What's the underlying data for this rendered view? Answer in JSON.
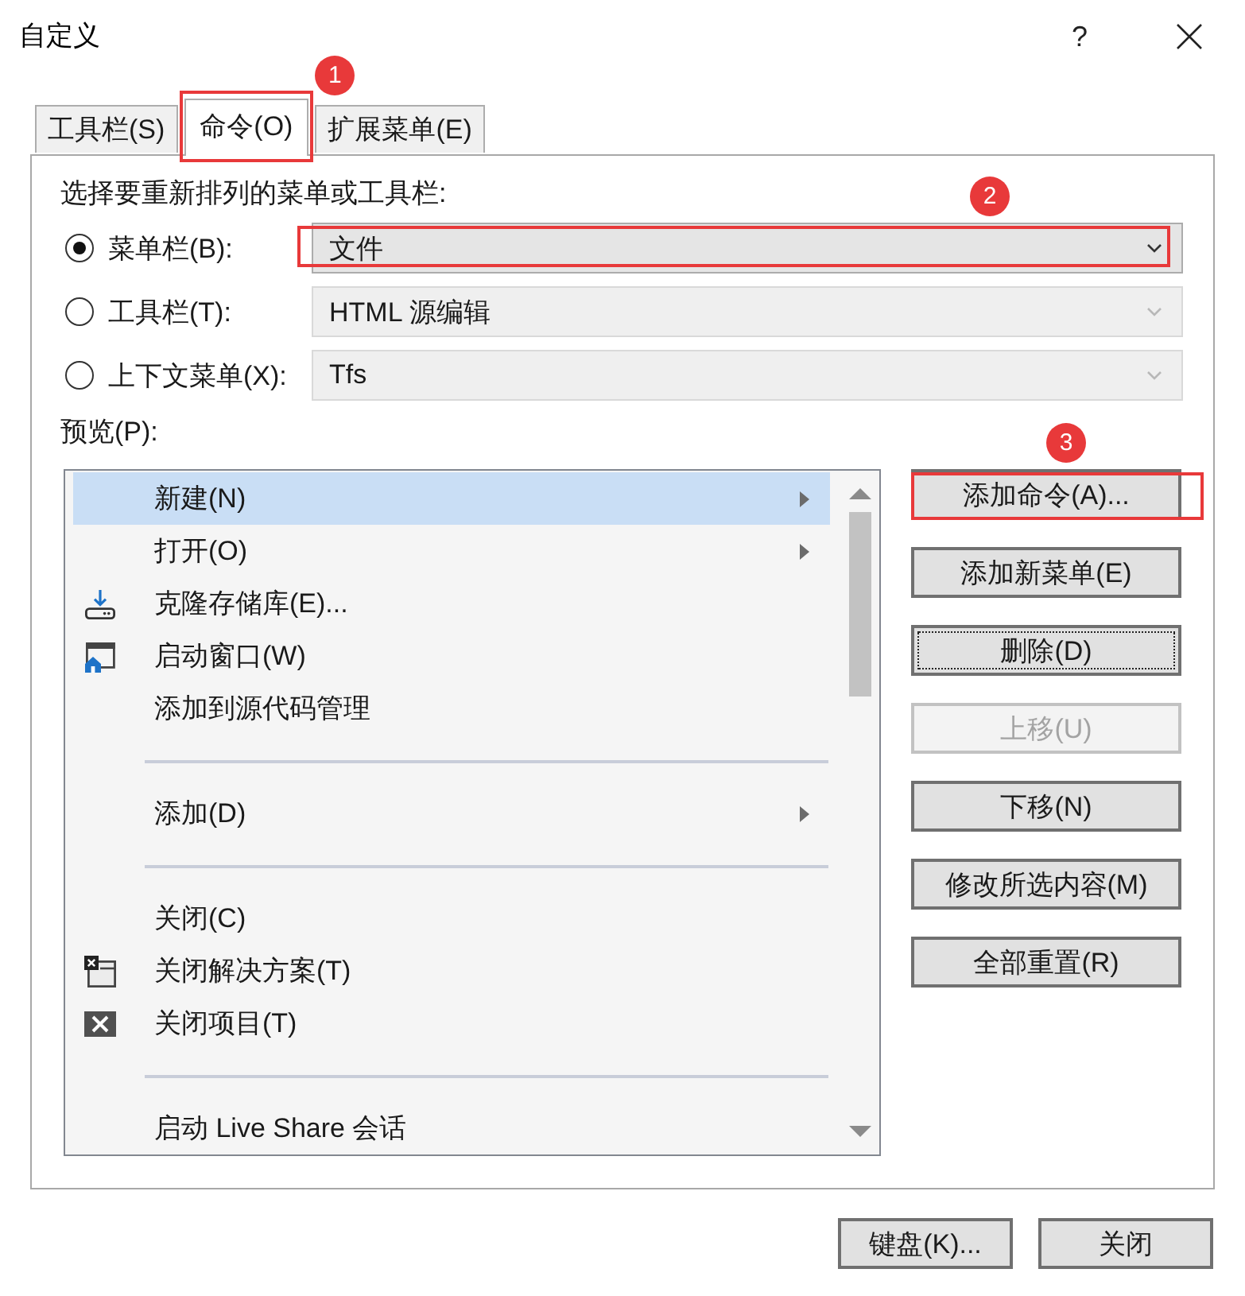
{
  "window": {
    "title": "自定义",
    "help_button": "?"
  },
  "tabs": [
    {
      "label": "工具栏(S)",
      "selected": false
    },
    {
      "label": "命令(O)",
      "selected": true,
      "callout": "1"
    },
    {
      "label": "扩展菜单(E)",
      "selected": false
    }
  ],
  "rearrange": {
    "prompt": "选择要重新排列的菜单或工具栏:",
    "options": [
      {
        "label": "菜单栏(B):",
        "selected": true,
        "value": "文件",
        "callout": "2"
      },
      {
        "label": "工具栏(T):",
        "selected": false,
        "value": "HTML 源编辑"
      },
      {
        "label": "上下文菜单(X):",
        "selected": false,
        "value": "Tfs"
      }
    ]
  },
  "preview": {
    "label": "预览(P):",
    "items": [
      {
        "kind": "command",
        "label": "新建(N)",
        "selected": true,
        "has_submenu": true
      },
      {
        "kind": "command",
        "label": "打开(O)",
        "selected": false,
        "has_submenu": true
      },
      {
        "kind": "clone",
        "label": "克隆存储库(E)...",
        "selected": false,
        "has_submenu": false
      },
      {
        "kind": "startwindow",
        "label": "启动窗口(W)",
        "selected": false,
        "has_submenu": false
      },
      {
        "kind": "command",
        "label": "添加到源代码管理",
        "selected": false,
        "has_submenu": false
      },
      {
        "kind": "separator"
      },
      {
        "kind": "command",
        "label": "添加(D)",
        "selected": false,
        "has_submenu": true
      },
      {
        "kind": "separator"
      },
      {
        "kind": "command",
        "label": "关闭(C)",
        "selected": false,
        "has_submenu": false
      },
      {
        "kind": "closesolution",
        "label": "关闭解决方案(T)",
        "selected": false,
        "has_submenu": false
      },
      {
        "kind": "closeproject",
        "label": "关闭项目(T)",
        "selected": false,
        "has_submenu": false
      },
      {
        "kind": "separator"
      },
      {
        "kind": "command",
        "label": "启动 Live Share 会话",
        "selected": false,
        "has_submenu": false
      }
    ]
  },
  "buttons": [
    {
      "label": "添加命令(A)...",
      "disabled": false,
      "focused": false,
      "callout": "3"
    },
    {
      "label": "添加新菜单(E)",
      "disabled": false,
      "focused": false
    },
    {
      "label": "删除(D)",
      "disabled": false,
      "focused": true
    },
    {
      "label": "上移(U)",
      "disabled": true,
      "focused": false
    },
    {
      "label": "下移(N)",
      "disabled": false,
      "focused": false
    },
    {
      "label": "修改所选内容(M)",
      "disabled": false,
      "focused": false
    },
    {
      "label": "全部重置(R)",
      "disabled": false,
      "focused": false
    }
  ],
  "footer_buttons": [
    {
      "label": "键盘(K)..."
    },
    {
      "label": "关闭"
    }
  ]
}
